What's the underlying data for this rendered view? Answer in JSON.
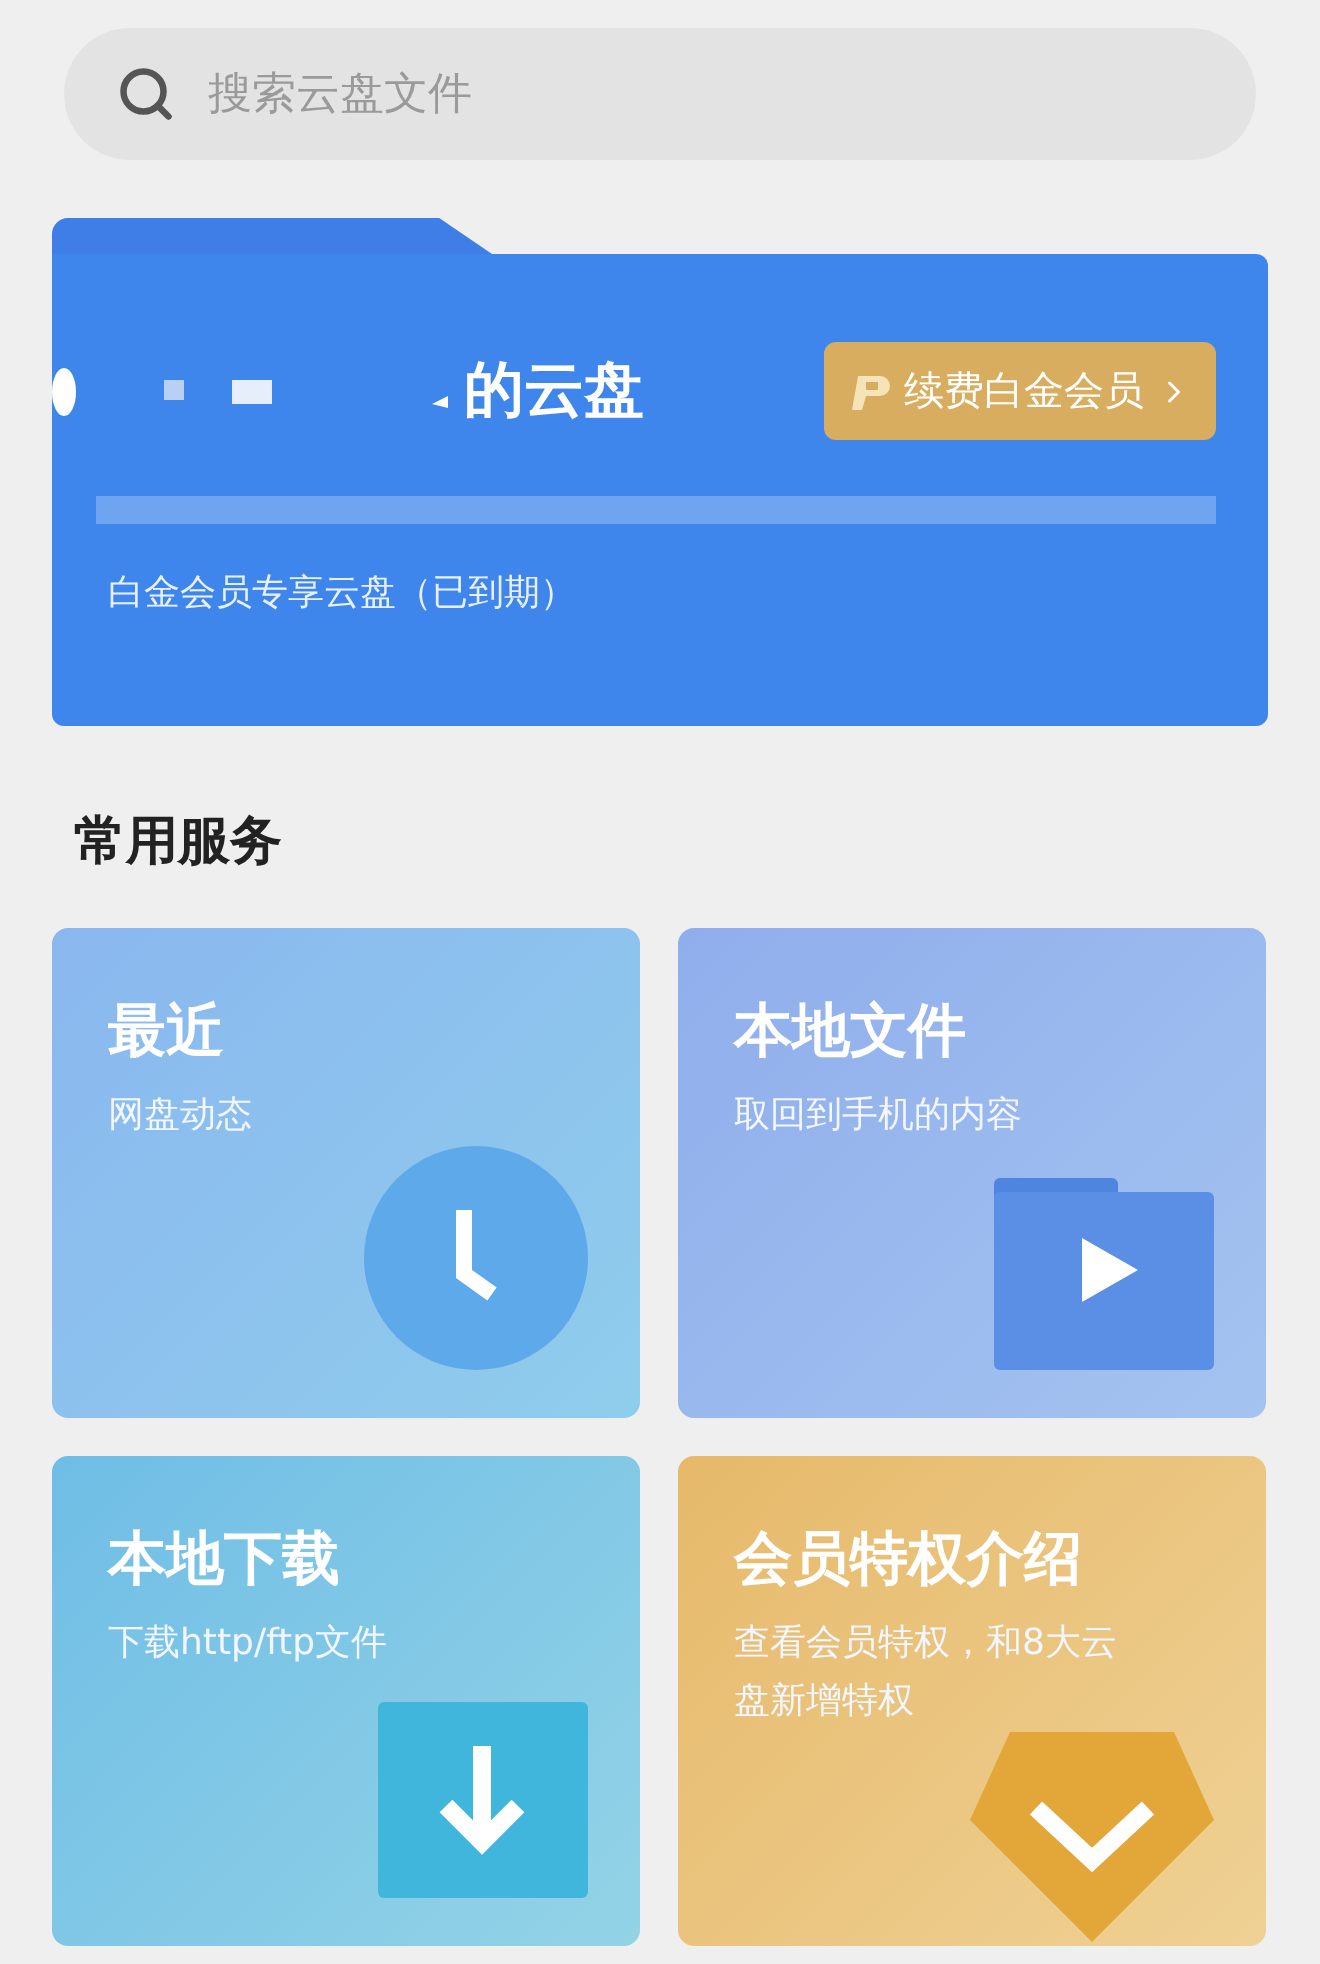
{
  "search": {
    "placeholder": "搜索云盘文件"
  },
  "cloud_card": {
    "title": "的云盘",
    "renew_button": "续费白金会员",
    "subtitle": "白金会员专享云盘（已到期）"
  },
  "services": {
    "title": "常用服务",
    "tiles": [
      {
        "kind": "clock",
        "title": "最近",
        "subtitle": "网盘动态"
      },
      {
        "kind": "folder",
        "title": "本地文件",
        "subtitle": "取回到手机的内容"
      },
      {
        "kind": "download",
        "title": "本地下载",
        "subtitle": "下载http/ftp文件"
      },
      {
        "kind": "vip",
        "title": "会员特权介绍",
        "subtitle": "查看会员特权，和8大云盘新增特权"
      }
    ]
  }
}
